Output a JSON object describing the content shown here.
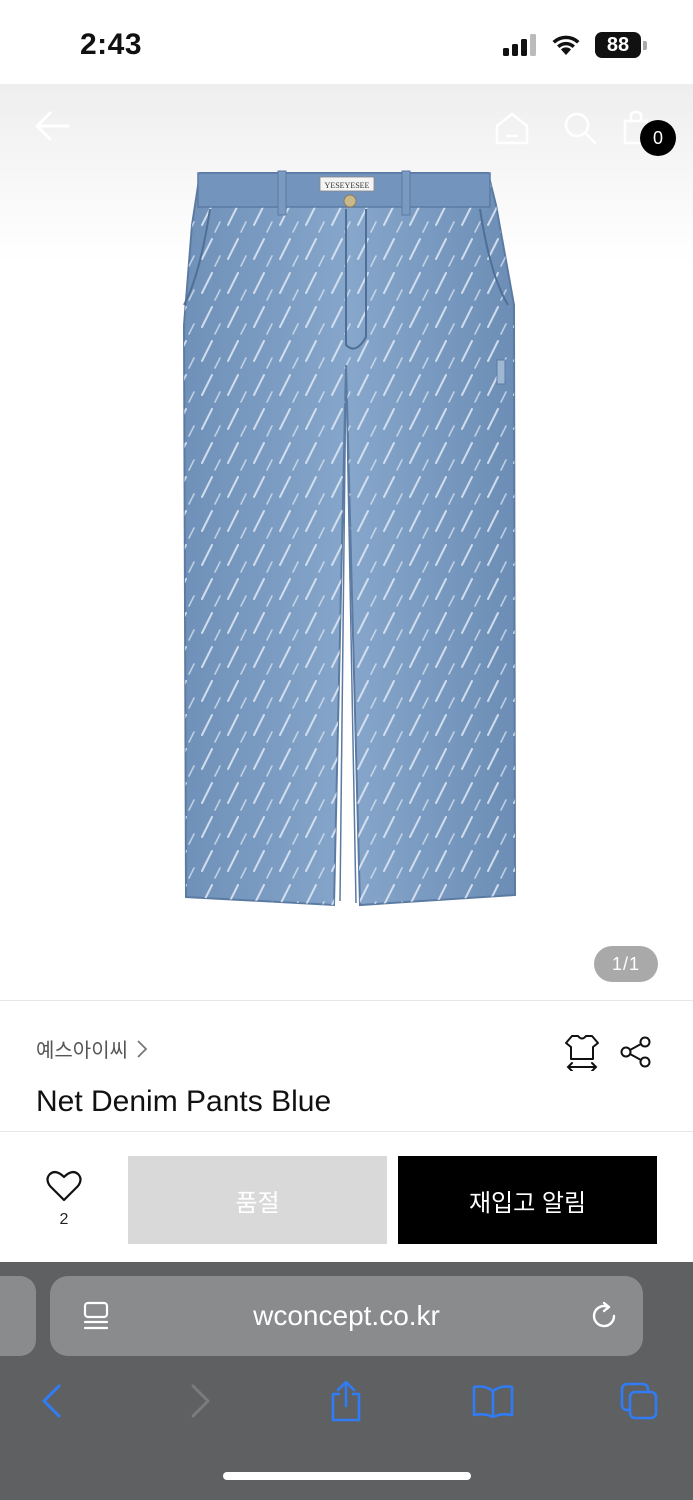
{
  "status": {
    "time": "2:43",
    "battery": "88"
  },
  "header": {
    "cart_count": "0"
  },
  "gallery": {
    "indicator": "1/1",
    "brand_tag": "YESEYESEE"
  },
  "product": {
    "brand": "예스아이씨",
    "title": "Net Denim Pants Blue"
  },
  "actions": {
    "like_count": "2",
    "sold_out_label": "품절",
    "restock_label": "재입고 알림"
  },
  "browser": {
    "url": "wconcept.co.kr"
  },
  "colors": {
    "denim": "#7d9ec4",
    "accent": "#000000",
    "safari_bar": "#5f6061",
    "link_blue": "#2f7cf6"
  },
  "icons": {
    "header": [
      "back-arrow-icon",
      "home-icon",
      "search-icon",
      "cart-icon"
    ],
    "info": [
      "size-guide-icon",
      "share-icon"
    ],
    "toolbar": [
      "back-icon",
      "forward-icon",
      "share-icon",
      "bookmarks-icon",
      "tabs-icon"
    ]
  }
}
